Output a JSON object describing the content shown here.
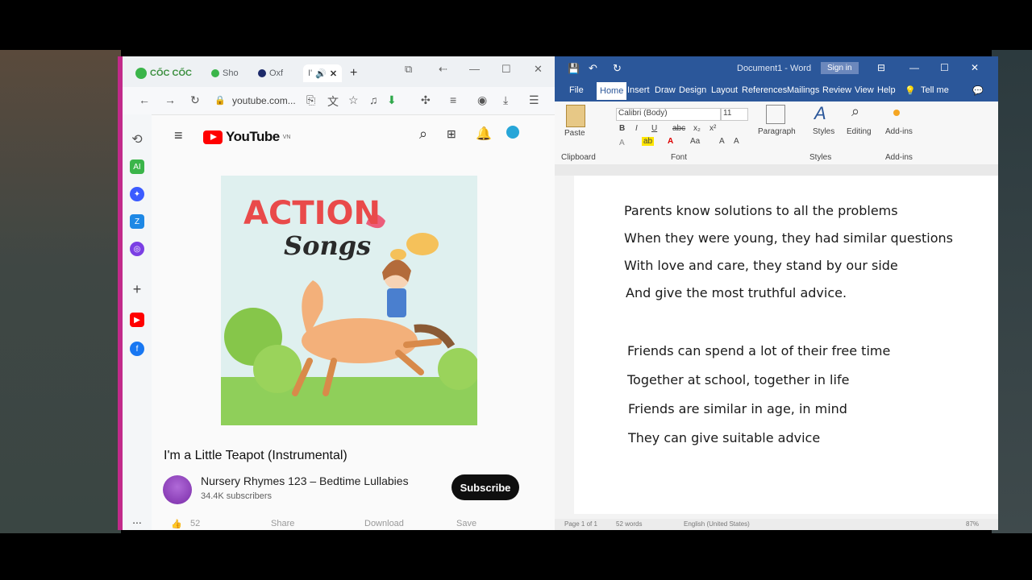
{
  "browser": {
    "brand": "CỐC CỐC",
    "tabs": [
      "Sho",
      "Oxf",
      "I'"
    ],
    "new_tab": "+",
    "url": "youtube.com...",
    "youtube": {
      "logo_text": "YouTube",
      "region": "VN",
      "video_title": "I'm a Little Teapot (Instrumental)",
      "channel_name": "Nursery Rhymes 123 – Bedtime Lullabies",
      "subscribers": "34.4K subscribers",
      "subscribe_label": "Subscribe",
      "thumbnail": {
        "title_word1": "ACTION",
        "title_word2": "Songs"
      },
      "actions": {
        "likes": "52",
        "share": "Share",
        "download": "Download",
        "save": "Save"
      }
    },
    "more": "..."
  },
  "word": {
    "title": "Document1 - Word",
    "signin": "Sign in",
    "tabs": [
      "File",
      "Home",
      "Insert",
      "Draw",
      "Design",
      "Layout",
      "References",
      "Mailings",
      "Review",
      "View",
      "Help",
      "Tell me"
    ],
    "active_tab": "Home",
    "ribbon": {
      "paste": "Paste",
      "clipboard": "Clipboard",
      "font_name": "Calibri (Body)",
      "font_size": "11",
      "font_group": "Font",
      "paragraph": "Paragraph",
      "styles": "Styles",
      "styles_group": "Styles",
      "editing": "Editing",
      "addins": "Add-ins",
      "addins_group": "Add-ins"
    },
    "document_lines": [
      "Parents know solutions to all the problems",
      "When they were young, they had similar questions",
      "With love and care, they stand by our side",
      "And give the most truthful advice.",
      "Friends can spend a lot of their free time",
      "Together at school, together in life",
      "Friends are similar in age, in mind",
      "They can give suitable advice"
    ],
    "status": {
      "page": "Page 1 of 1",
      "words": "52 words",
      "language": "English (United States)",
      "zoom": "87%"
    }
  },
  "colors": {
    "word_blue": "#2b579a",
    "yt_red": "#ff0000",
    "browser_accent": "#c22a8a"
  }
}
